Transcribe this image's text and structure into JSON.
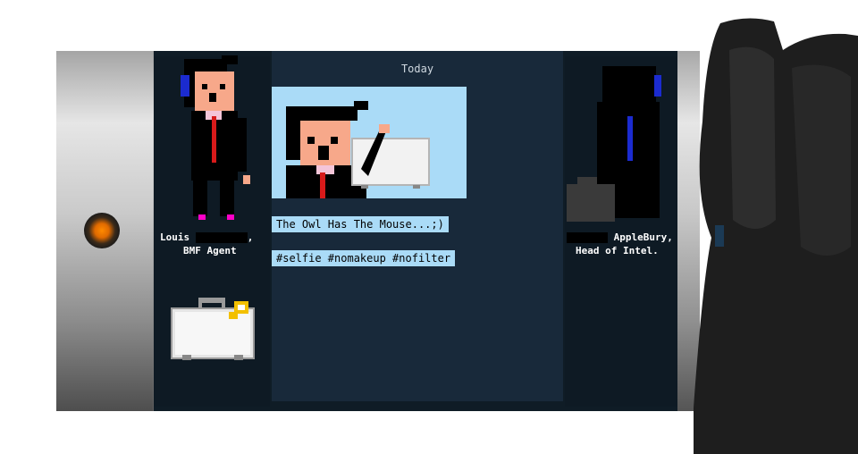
{
  "screen": {
    "header": "Today"
  },
  "post": {
    "caption1": "The Owl Has The Mouse...;)",
    "caption2": "#selfie #nomakeup #nofilter",
    "photo_icon": "selfie-photo-icon"
  },
  "left_contact": {
    "first_name": "Louis",
    "suffix": ",",
    "title": "BMF Agent",
    "avatar_icon": "agent-avatar-icon"
  },
  "right_contact": {
    "last_name": "AppleBury,",
    "title": "Head of Intel.",
    "avatar_icon": "shadow-avatar-icon"
  },
  "inventory": {
    "item_icon": "briefcase-key-icon"
  },
  "colors": {
    "caption_bg": "#aadbf7",
    "screen_bg": "#18293a",
    "indicator": "#ff8a00"
  }
}
